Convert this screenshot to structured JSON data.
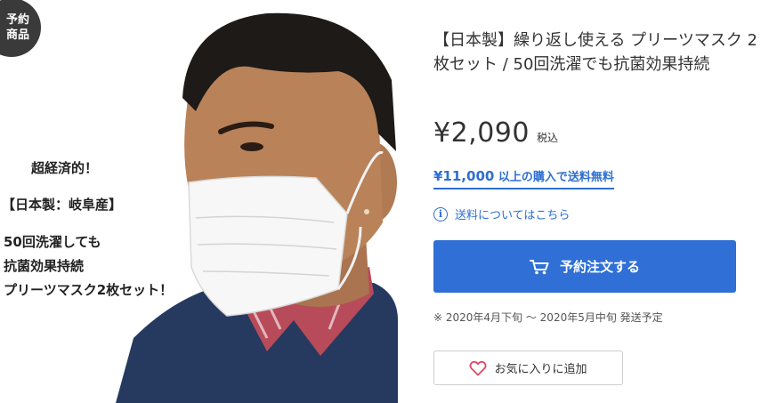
{
  "badge": {
    "line1": "予約",
    "line2": "商品"
  },
  "image_text": {
    "line1": "超経済的！",
    "line2": "【日本製：岐阜産】",
    "line3": "50回洗濯しても",
    "line4": "抗菌効果持続",
    "line5": "プリーツマスク2枚セット！"
  },
  "product": {
    "title": "【日本製】繰り返し使える プリーツマスク 2枚セット / 50回洗濯でも抗菌効果持続",
    "price": "¥2,090",
    "tax_label": "税込",
    "free_shipping_amount": "¥11,000",
    "free_shipping_text": "以上の購入で送料無料",
    "shipping_link": "送料についてはこちら",
    "order_button": "予約注文する",
    "release_note": "※ 2020年4月下旬 〜 2020年5月中旬 発送予定",
    "favorite_button": "お気に入りに追加"
  },
  "icons": {
    "info": "info-circle-icon",
    "cart": "cart-icon",
    "heart": "heart-outline-icon"
  },
  "colors": {
    "accent": "#2f6fd6",
    "link": "#2d6fd1",
    "heart": "#e0475f",
    "badge_bg": "#3a3a3a"
  }
}
